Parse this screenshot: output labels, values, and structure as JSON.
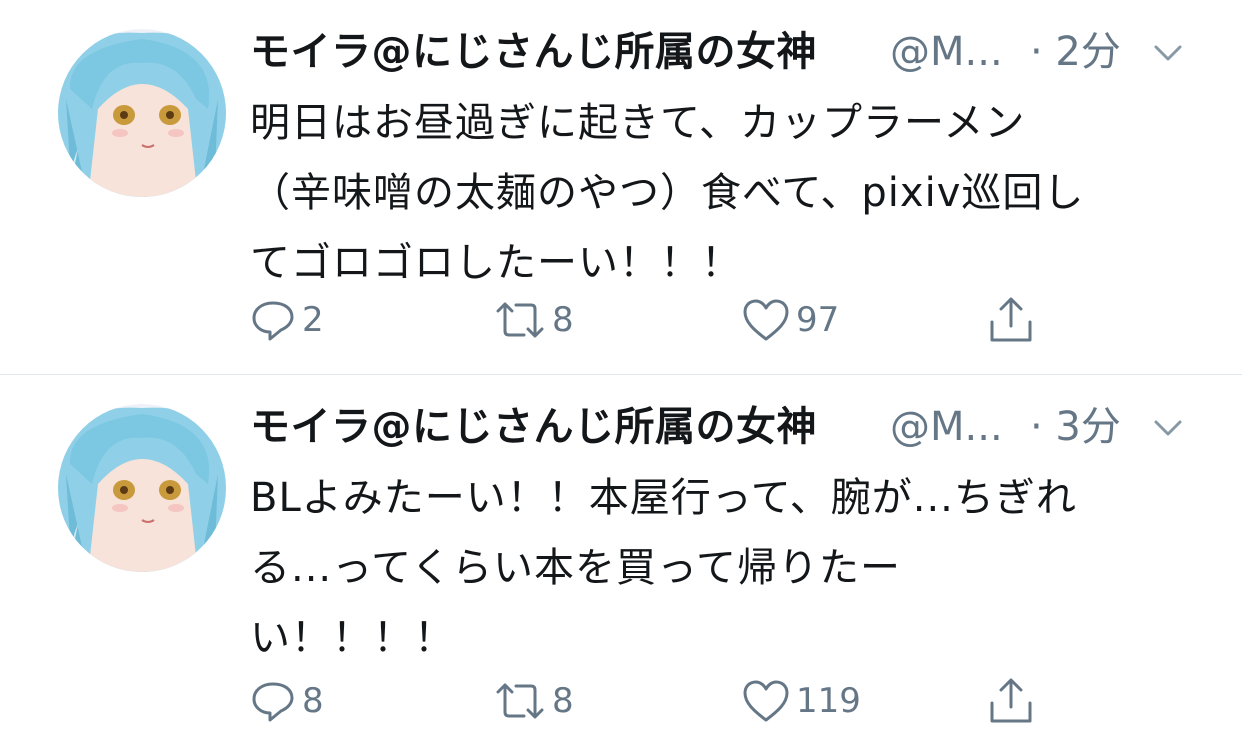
{
  "colors": {
    "text": "#14171a",
    "secondary": "#657786",
    "divider": "#e1e8ed",
    "background": "#ffffff"
  },
  "tweets": [
    {
      "display_name": "モイラ@にじさんじ所属の女神",
      "handle": "@M...",
      "time": "· 2分",
      "lines": [
        "明日はお昼過ぎに起きて、カップラーメン",
        "（辛味噌の太麺のやつ）食べて、pixiv巡回し",
        "てゴロゴロしたーい！！！"
      ],
      "replies": "2",
      "retweets": "8",
      "likes": "97",
      "icons": [
        "reply-icon",
        "retweet-icon",
        "like-icon",
        "share-icon",
        "chevron-down-icon"
      ]
    },
    {
      "display_name": "モイラ@にじさんじ所属の女神",
      "handle": "@M...",
      "time": "· 3分",
      "lines": [
        "BLよみたーい！！本屋行って、腕が...ちぎれ",
        "る...ってくらい本を買って帰りたー",
        "い！！！！"
      ],
      "replies": "8",
      "retweets": "8",
      "likes": "119",
      "icons": [
        "reply-icon",
        "retweet-icon",
        "like-icon",
        "share-icon",
        "chevron-down-icon"
      ]
    }
  ]
}
